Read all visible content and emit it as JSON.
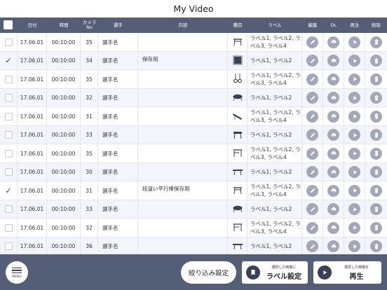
{
  "title": "My Video",
  "header": {
    "date": "日付",
    "time": "時間",
    "camera": "カメラ\nNo",
    "athlete": "選手",
    "content": "内容",
    "event": "種目",
    "label": "ラベル",
    "edit": "編集",
    "dl": "DL",
    "play": "再生",
    "delete": "削除"
  },
  "rows": [
    {
      "checked": false,
      "date": "17.06.01",
      "time": "00:10:00",
      "camera": "35",
      "athlete": "選手名",
      "content": "",
      "apparatus": "parallel-bars-icon",
      "label": "ラベル1, ラベル2, ラベル3, ラベル4"
    },
    {
      "checked": true,
      "date": "17.06.01",
      "time": "00:10:00",
      "camera": "34",
      "athlete": "選手名",
      "content": "保存用",
      "apparatus": "floor-icon",
      "label": "ラベル1, ラベル2"
    },
    {
      "checked": false,
      "date": "17.06.01",
      "time": "00:10:00",
      "camera": "35",
      "athlete": "選手名",
      "content": "",
      "apparatus": "rings-icon",
      "label": "ラベル1, ラベル2, ラベル3, ラベル4"
    },
    {
      "checked": false,
      "date": "17.06.01",
      "time": "00:10:00",
      "camera": "32",
      "athlete": "選手名",
      "content": "",
      "apparatus": "trampoline-icon",
      "label": "ラベル1, ラベル2"
    },
    {
      "checked": false,
      "date": "17.06.01",
      "time": "00:10:00",
      "camera": "31",
      "athlete": "選手名",
      "content": "",
      "apparatus": "vault-icon",
      "label": "ラベル1, ラベル2, ラベル3, ラベル4"
    },
    {
      "checked": false,
      "date": "17.06.01",
      "time": "00:10:00",
      "camera": "33",
      "athlete": "選手名",
      "content": "",
      "apparatus": "pommel-horse-icon",
      "label": "ラベル1, ラベル2"
    },
    {
      "checked": false,
      "date": "17.06.01",
      "time": "00:10:00",
      "camera": "35",
      "athlete": "選手名",
      "content": "",
      "apparatus": "uneven-bars-icon",
      "label": "ラベル1, ラベル2, ラベル3, ラベル4"
    },
    {
      "checked": false,
      "date": "17.06.01",
      "time": "00:10:00",
      "camera": "30",
      "athlete": "選手名",
      "content": "",
      "apparatus": "balance-beam-icon",
      "label": "ラベル1, ラベル2"
    },
    {
      "checked": true,
      "date": "17.06.01",
      "time": "00:10:00",
      "camera": "31",
      "athlete": "選手名",
      "content": "段違い平行棒保存用",
      "apparatus": "parallel-bars-icon",
      "label": "ラベル1, ラベル2, ラベル3, ラベル4"
    },
    {
      "checked": false,
      "date": "17.06.01",
      "time": "00:10:00",
      "camera": "33",
      "athlete": "選手名",
      "content": "",
      "apparatus": "trampoline-icon",
      "label": "ラベル1, ラベル2"
    },
    {
      "checked": false,
      "date": "17.06.01",
      "time": "00:10:00",
      "camera": "32",
      "athlete": "選手名",
      "content": "",
      "apparatus": "uneven-bars-icon",
      "label": "ラベル1, ラベル2, ラベル3, ラベル4"
    },
    {
      "checked": false,
      "date": "17.06.01",
      "time": "00:10:00",
      "camera": "36",
      "athlete": "選手名",
      "content": "",
      "apparatus": "balance-beam-icon",
      "label": "ラベル1, ラベル2"
    }
  ],
  "footer": {
    "menu_label": "MENU",
    "filter_label": "絞り込み設定",
    "label_button_small": "選択した映像に",
    "label_button_large": "ラベル設定",
    "play_button_small": "選択した映像を",
    "play_button_large": "再生"
  },
  "colors": {
    "header_bg": "#555e77",
    "action_icon_bg": "#a3a8b8",
    "alt_row_bg": "#f2f5fb"
  }
}
